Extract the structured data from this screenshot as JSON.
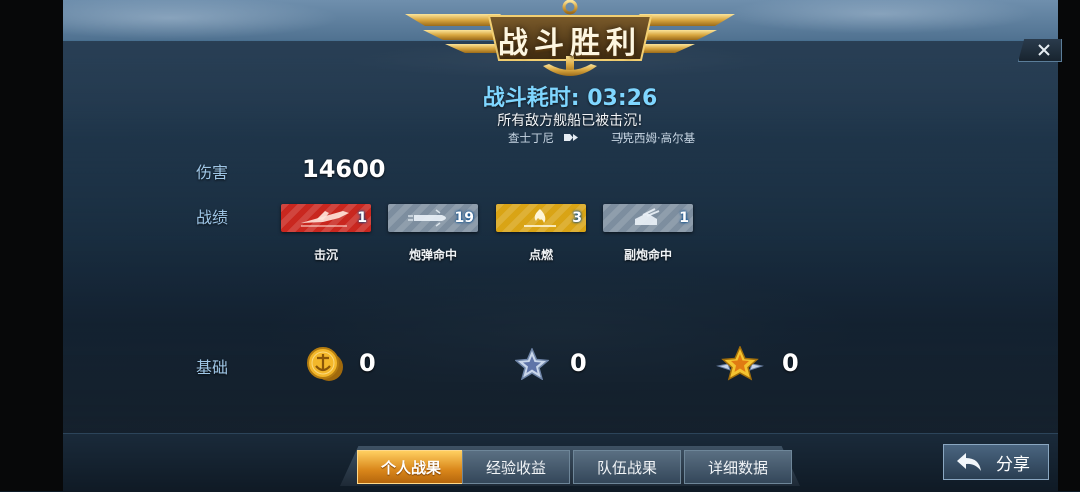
{
  "header": {
    "title": "战斗胜利",
    "battle_time_label": "战斗耗时:",
    "battle_time_value": "03:26",
    "result_message": "所有敌方舰船已被击沉!",
    "kill_feed": {
      "killer": "查士丁尼",
      "separator": "III",
      "victim": "马克西姆·高尔基"
    }
  },
  "close_button": {
    "label": "✕"
  },
  "damage": {
    "label": "伤害",
    "value": "14600"
  },
  "achievements": {
    "label": "战绩",
    "items": [
      {
        "name": "击沉",
        "count": "1",
        "color": "#c9271f",
        "icon": "plane-sinking-icon"
      },
      {
        "name": "炮弹命中",
        "count": "19",
        "color": "#7d8e9f",
        "icon": "shell-icon"
      },
      {
        "name": "点燃",
        "count": "3",
        "color": "#d9a415",
        "icon": "fire-icon"
      },
      {
        "name": "副炮命中",
        "count": "1",
        "color": "#7d8e9f",
        "icon": "secondary-gun-icon"
      }
    ]
  },
  "rewards": {
    "label": "基础",
    "items": [
      {
        "icon": "gold-coin-icon",
        "value": "0"
      },
      {
        "icon": "silver-star-icon",
        "value": "0"
      },
      {
        "icon": "gold-star-icon",
        "value": "0"
      }
    ]
  },
  "tabs": [
    {
      "label": "个人战果",
      "active": true
    },
    {
      "label": "经验收益",
      "active": false
    },
    {
      "label": "队伍战果",
      "active": false
    },
    {
      "label": "详细数据",
      "active": false
    }
  ],
  "share_button": {
    "label": "分享",
    "icon": "share-arrow-icon"
  },
  "colors": {
    "accent_blue": "#7fd6ff",
    "label_blue": "#9fc6e6",
    "tab_active": "#e0961f"
  }
}
